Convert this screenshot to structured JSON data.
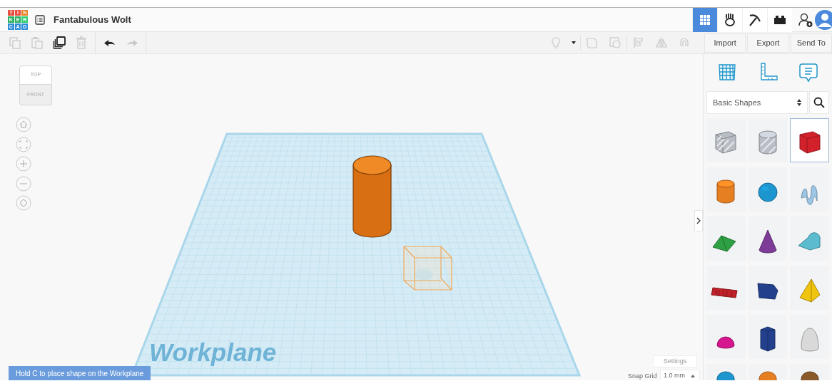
{
  "header": {
    "logo_letters": [
      "T",
      "I",
      "N",
      "K",
      "E",
      "R",
      "C",
      "A",
      "D"
    ],
    "title": "Fantabulous Wolt"
  },
  "views": [
    {
      "kind": "grid",
      "selected": true
    },
    {
      "kind": "hand",
      "selected": false
    },
    {
      "kind": "pickaxe",
      "selected": false
    },
    {
      "kind": "brick",
      "selected": false
    }
  ],
  "toolbar": [
    {
      "kind": "copy",
      "disabled": true
    },
    {
      "kind": "paste",
      "disabled": true
    },
    {
      "kind": "duplicate",
      "disabled": false
    },
    {
      "kind": "delete",
      "disabled": true
    },
    {
      "kind": "undo",
      "disabled": false
    },
    {
      "kind": "redo",
      "disabled": true
    }
  ],
  "edit_tools": [
    {
      "kind": "bulb",
      "disabled": true
    },
    {
      "kind": "dropdown",
      "disabled": false
    },
    {
      "kind": "group",
      "disabled": true
    },
    {
      "kind": "ungroup",
      "disabled": true
    },
    {
      "kind": "align",
      "disabled": true
    },
    {
      "kind": "mirror",
      "disabled": true
    },
    {
      "kind": "magnet",
      "disabled": true
    }
  ],
  "actions": [
    "Import",
    "Export",
    "Send To"
  ],
  "view_cube": {
    "top": "TOP",
    "front": "FRONT"
  },
  "workplane": {
    "label": "Workplane"
  },
  "hint": "Hold C to place shape on the Workplane",
  "settings_button": "Settings",
  "snap_grid": {
    "label": "Snap Grid",
    "value": "1.0 mm"
  },
  "panel": {
    "category": "Basic Shapes",
    "shapes": [
      {
        "kind": "box-hole",
        "color": "#b8bcc4",
        "selected": false
      },
      {
        "kind": "cylinder-hole",
        "color": "#b8bcc4",
        "selected": false
      },
      {
        "kind": "box",
        "color": "#d3212c",
        "selected": true
      },
      {
        "kind": "cylinder",
        "color": "#e67e22",
        "selected": false
      },
      {
        "kind": "sphere",
        "color": "#1d96cf",
        "selected": false
      },
      {
        "kind": "scribble",
        "color": "#9cc6e6",
        "selected": false
      },
      {
        "kind": "roof",
        "color": "#2ea043",
        "selected": false
      },
      {
        "kind": "cone",
        "color": "#7d3c98",
        "selected": false
      },
      {
        "kind": "round-roof",
        "color": "#5bbccf",
        "selected": false
      },
      {
        "kind": "text",
        "color": "#c0202a",
        "selected": false
      },
      {
        "kind": "wedge",
        "color": "#22408c",
        "selected": false
      },
      {
        "kind": "pyramid",
        "color": "#f1c40f",
        "selected": false
      },
      {
        "kind": "half-sphere",
        "color": "#d6168f",
        "selected": false
      },
      {
        "kind": "polygon",
        "color": "#22408c",
        "selected": false
      },
      {
        "kind": "paraboloid",
        "color": "#d9d9d9",
        "selected": false
      },
      {
        "kind": "partial",
        "color": "#1d96cf",
        "selected": false
      },
      {
        "kind": "partial",
        "color": "#e67e22",
        "selected": false
      },
      {
        "kind": "partial",
        "color": "#8a5a2b",
        "selected": false
      }
    ]
  }
}
